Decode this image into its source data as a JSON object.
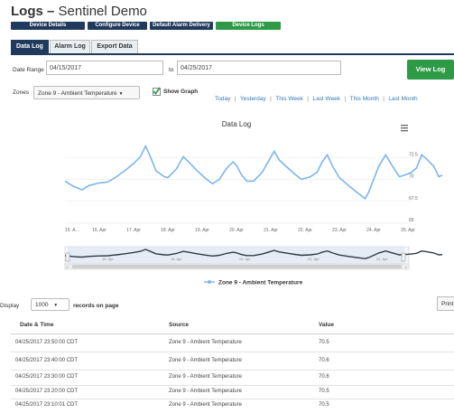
{
  "header": {
    "title_bold": "Logs –",
    "title_rest": "Sentinel Demo"
  },
  "nav_buttons": [
    "Device Details",
    "Configure Device",
    "Default Alarm Delivery",
    "Device Logs"
  ],
  "tabs": [
    "Data Log",
    "Alarm Log",
    "Export Data"
  ],
  "filters": {
    "date_range_label": "Date Range",
    "start_date": "04/15/2017",
    "to_label": "to",
    "end_date": "04/25/2017",
    "view_log": "View Log",
    "zones_label": "Zones",
    "zone_selected": "Zone 9 - Ambient Temperature",
    "show_graph_label": "Show Graph",
    "quick_ranges": [
      "Today",
      "Yesterday",
      "This Week",
      "Last Week",
      "This Month",
      "Last Month"
    ]
  },
  "chart_data": {
    "type": "line",
    "title": "Data Log",
    "x_ticks": [
      "15. A…",
      "16. Apr",
      "17. Apr",
      "18. Apr",
      "19. Apr",
      "20. Apr",
      "21. Apr",
      "22. Apr",
      "23. Apr",
      "24. Apr",
      "25. Apr"
    ],
    "y_ticks": [
      "72.5",
      "70",
      "67.5",
      "65"
    ],
    "ylim": [
      65,
      75
    ],
    "grid": true,
    "legend_position": "bottom",
    "series": [
      {
        "name": "Zone 9 - Ambient Temperature",
        "color": "#7cb5ec",
        "points": [
          [
            0.0,
            69.8
          ],
          [
            0.25,
            69.2
          ],
          [
            0.5,
            68.8
          ],
          [
            0.7,
            69.3
          ],
          [
            1.0,
            69.6
          ],
          [
            1.25,
            69.7
          ],
          [
            1.5,
            70.3
          ],
          [
            1.75,
            71.0
          ],
          [
            2.0,
            71.8
          ],
          [
            2.2,
            72.6
          ],
          [
            2.35,
            73.8
          ],
          [
            2.5,
            72.5
          ],
          [
            2.65,
            71.0
          ],
          [
            2.9,
            70.3
          ],
          [
            3.0,
            70.2
          ],
          [
            3.25,
            71.2
          ],
          [
            3.45,
            72.6
          ],
          [
            3.6,
            72.0
          ],
          [
            3.85,
            71.0
          ],
          [
            4.1,
            70.1
          ],
          [
            4.3,
            69.5
          ],
          [
            4.5,
            70.0
          ],
          [
            4.7,
            71.2
          ],
          [
            4.9,
            72.0
          ],
          [
            5.0,
            71.6
          ],
          [
            5.15,
            70.5
          ],
          [
            5.3,
            69.8
          ],
          [
            5.5,
            69.8
          ],
          [
            5.75,
            70.8
          ],
          [
            5.95,
            72.2
          ],
          [
            6.1,
            73.2
          ],
          [
            6.25,
            72.2
          ],
          [
            6.5,
            71.3
          ],
          [
            6.7,
            70.6
          ],
          [
            6.9,
            70.0
          ],
          [
            7.15,
            70.3
          ],
          [
            7.35,
            70.8
          ],
          [
            7.5,
            72.0
          ],
          [
            7.65,
            72.8
          ],
          [
            7.8,
            71.5
          ],
          [
            8.0,
            70.2
          ],
          [
            8.3,
            69.2
          ],
          [
            8.55,
            68.4
          ],
          [
            8.75,
            67.8
          ],
          [
            8.85,
            68.5
          ],
          [
            9.0,
            70.0
          ],
          [
            9.15,
            71.5
          ],
          [
            9.35,
            72.8
          ],
          [
            9.55,
            71.5
          ],
          [
            9.75,
            70.3
          ],
          [
            9.9,
            70.5
          ],
          [
            10.1,
            70.8
          ],
          [
            10.25,
            71.3
          ],
          [
            10.4,
            72.8
          ],
          [
            10.55,
            72.3
          ],
          [
            10.75,
            71.5
          ],
          [
            10.9,
            70.3
          ],
          [
            11.0,
            70.5
          ]
        ]
      }
    ]
  },
  "data_table": {
    "display_label": "Display",
    "page_size": "1000",
    "records_label": "records on page",
    "print_label": "Print",
    "columns": [
      "Date & Time",
      "Source",
      "Value"
    ],
    "rows": [
      [
        "04/25/2017 23:50:00 CDT",
        "Zone 9 - Ambient Temperature",
        "70.5"
      ],
      [
        "04/25/2017 23:40:00 CDT",
        "Zone 9 - Ambient Temperature",
        "70.6"
      ],
      [
        "04/25/2017 23:30:00 CDT",
        "Zone 9 - Ambient Temperature",
        "70.6"
      ],
      [
        "04/25/2017 23:20:00 CDT",
        "Zone 9 - Ambient Temperature",
        "70.5"
      ],
      [
        "04/25/2017 23:10:01 CDT",
        "Zone 9 - Ambient Temperature",
        "70.5"
      ]
    ]
  }
}
